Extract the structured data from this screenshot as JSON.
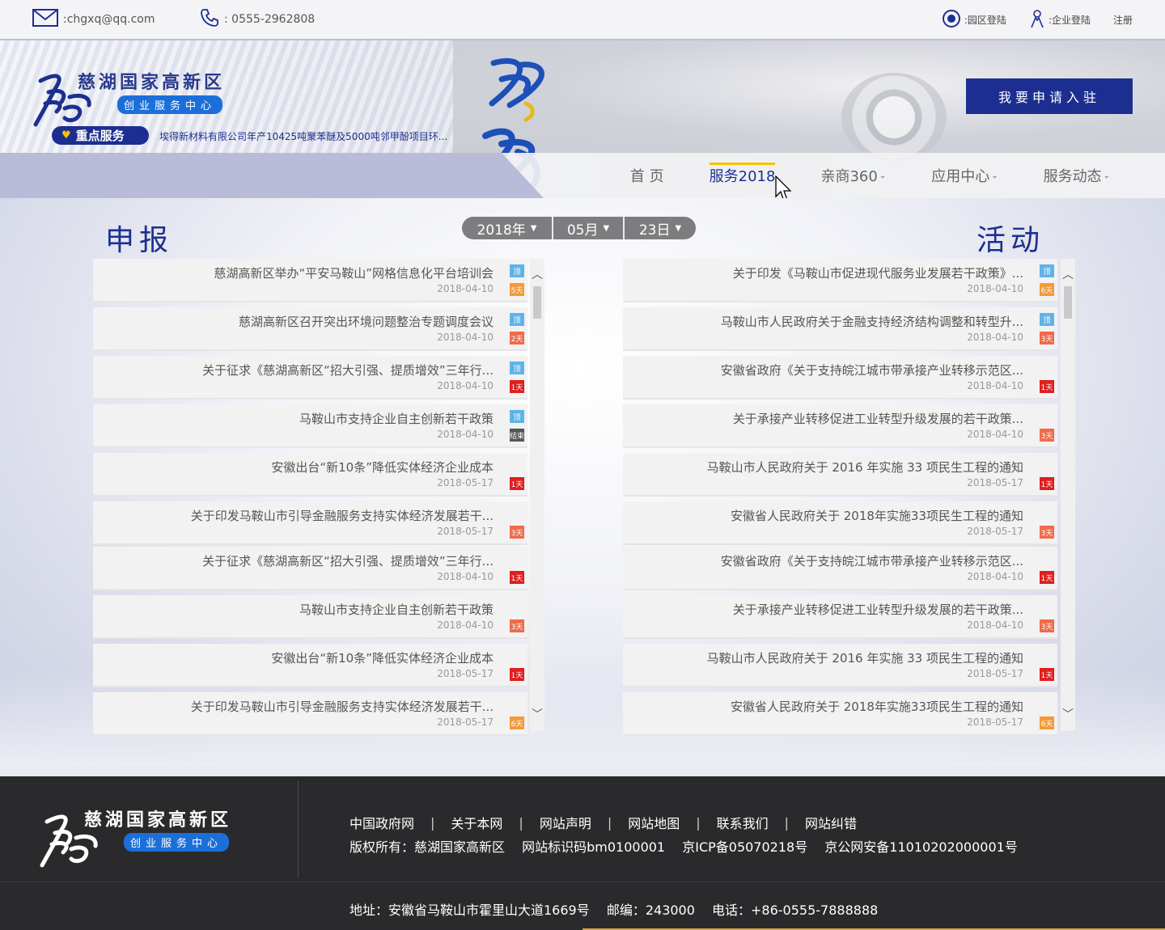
{
  "topbar": {
    "email": ":chgxq@qq.com",
    "phone": ": 0555-2962808",
    "park_login": ":园区登陆",
    "company_login": ":企业登陆",
    "register": "注册"
  },
  "header": {
    "logo_name": "慈湖国家高新区",
    "logo_sub": "创业服务中心",
    "apply_button": "我要申请入驻",
    "key_service": "重点服务",
    "ticker": "埃得新材料有限公司年产10425吨聚苯醚及5000吨邻甲酚项目环...",
    "nav": [
      {
        "label": "首 页",
        "active": false,
        "caret": false
      },
      {
        "label": "服务2018",
        "active": true,
        "caret": false
      },
      {
        "label": "亲商360",
        "active": false,
        "caret": true
      },
      {
        "label": "应用中心",
        "active": false,
        "caret": true
      },
      {
        "label": "服务动态",
        "active": false,
        "caret": true
      }
    ]
  },
  "main": {
    "left_title": "申报",
    "right_title": "活动",
    "date": {
      "year": "2018年",
      "month": "05月",
      "day": "23日"
    },
    "left_list": [
      {
        "title": "慈湖高新区举办“平安马鞍山”网格信息化平台培训会",
        "date": "2018-04-10",
        "top": "顶",
        "days": "5天",
        "days_color": "#f39a3a"
      },
      {
        "title": "慈湖高新区召开突出环境问题整治专题调度会议",
        "date": "2018-04-10",
        "top": "顶",
        "days": "2天",
        "days_color": "#ef6b4a"
      },
      {
        "title": "关于征求《慈湖高新区“招大引强、提质增效”三年行...",
        "date": "2018-04-10",
        "top": "顶",
        "days": "1天",
        "days_color": "#e01e1e"
      },
      {
        "title": "马鞍山市支持企业自主创新若干政策",
        "date": "2018-04-10",
        "top": "顶",
        "days": "结束",
        "days_color": "#555555"
      },
      {
        "title": "安徽出台“新10条”降低实体经济企业成本",
        "date": "2018-05-17",
        "top": "",
        "days": "1天",
        "days_color": "#e01e1e"
      },
      {
        "title": "关于印发马鞍山市引导金融服务支持实体经济发展若干...",
        "date": "2018-05-17",
        "top": "",
        "days": "3天",
        "days_color": "#ef6b4a"
      },
      {
        "title": "关于征求《慈湖高新区“招大引强、提质增效”三年行...",
        "date": "2018-04-10",
        "top": "",
        "days": "1天",
        "days_color": "#e01e1e"
      },
      {
        "title": "马鞍山市支持企业自主创新若干政策",
        "date": "2018-04-10",
        "top": "",
        "days": "3天",
        "days_color": "#ef6b4a"
      },
      {
        "title": "安徽出台“新10条”降低实体经济企业成本",
        "date": "2018-05-17",
        "top": "",
        "days": "1天",
        "days_color": "#e01e1e"
      },
      {
        "title": "关于印发马鞍山市引导金融服务支持实体经济发展若干...",
        "date": "2018-05-17",
        "top": "",
        "days": "6天",
        "days_color": "#f39a3a"
      }
    ],
    "right_list": [
      {
        "title": "关于印发《马鞍山市促进现代服务业发展若干政策》...",
        "date": "2018-04-10",
        "top": "顶",
        "days": "6天",
        "days_color": "#f39a3a"
      },
      {
        "title": "马鞍山市人民政府关于金融支持经济结构调整和转型升...",
        "date": "2018-04-10",
        "top": "顶",
        "days": "3天",
        "days_color": "#ef6b4a"
      },
      {
        "title": "安徽省政府《关于支持皖江城市带承接产业转移示范区...",
        "date": "2018-04-10",
        "top": "",
        "days": "1天",
        "days_color": "#e01e1e"
      },
      {
        "title": "关于承接产业转移促进工业转型升级发展的若干政策...",
        "date": "2018-04-10",
        "top": "",
        "days": "3天",
        "days_color": "#ef6b4a"
      },
      {
        "title": "马鞍山市人民政府关于 2016 年实施 33 项民生工程的通知",
        "date": "2018-05-17",
        "top": "",
        "days": "1天",
        "days_color": "#e01e1e"
      },
      {
        "title": "安徽省人民政府关于 2018年实施33项民生工程的通知",
        "date": "2018-05-17",
        "top": "",
        "days": "3天",
        "days_color": "#ef6b4a"
      },
      {
        "title": "安徽省政府《关于支持皖江城市带承接产业转移示范区...",
        "date": "2018-04-10",
        "top": "",
        "days": "1天",
        "days_color": "#e01e1e"
      },
      {
        "title": "关于承接产业转移促进工业转型升级发展的若干政策...",
        "date": "2018-04-10",
        "top": "",
        "days": "3天",
        "days_color": "#ef6b4a"
      },
      {
        "title": "马鞍山市人民政府关于 2016 年实施 33 项民生工程的通知",
        "date": "2018-05-17",
        "top": "",
        "days": "1天",
        "days_color": "#e01e1e"
      },
      {
        "title": "安徽省人民政府关于 2018年实施33项民生工程的通知",
        "date": "2018-05-17",
        "top": "",
        "days": "6天",
        "days_color": "#f39a3a"
      }
    ]
  },
  "footer": {
    "logo_name": "慈湖国家高新区",
    "logo_sub": "创业服务中心",
    "links": [
      "中国政府网",
      "关于本网",
      "网站声明",
      "网站地图",
      "联系我们",
      "网站纠错"
    ],
    "link_sep": "|",
    "copyright": "版权所有：慈湖国家高新区",
    "site_id": "网站标识码bm0100001",
    "icp": "京ICP备05070218号",
    "police": "京公网安备11010202000001号",
    "address": "地址：安徽省马鞍山市霍里山大道1669号",
    "postcode": "邮编：243000",
    "tel": "电话：+86-0555-7888888"
  },
  "colors": {
    "brand_navy": "#1c2f91",
    "accent_yellow": "#f5c300",
    "logo_blue": "#1c6fd9",
    "top_tag": "#5fb3e8"
  }
}
